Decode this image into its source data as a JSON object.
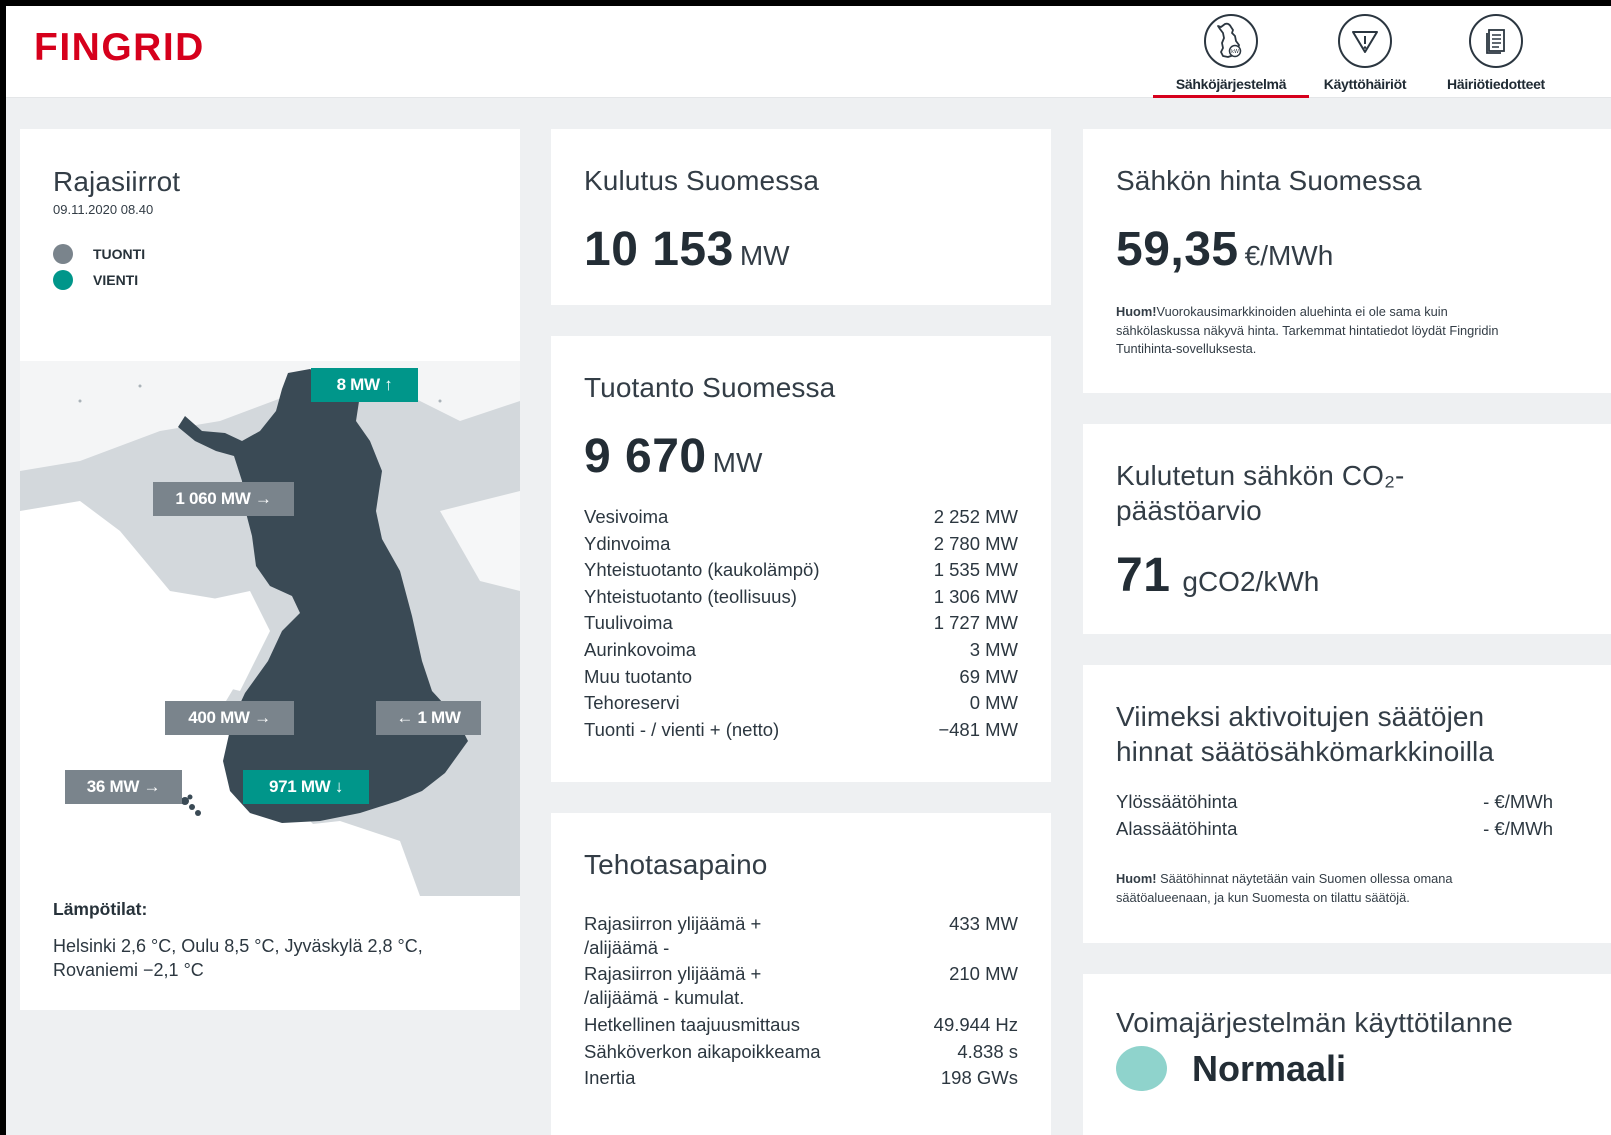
{
  "header": {
    "logo": "FINGRID",
    "nav": [
      {
        "label": "Sähköjärjestelmä",
        "icon": "finland-map-icon",
        "active": true
      },
      {
        "label": "Käyttöhäiriöt",
        "icon": "warning-triangle-icon",
        "active": false
      },
      {
        "label": "Häiriötiedotteet",
        "icon": "document-icon",
        "active": false
      }
    ]
  },
  "rajasiirrot": {
    "title": "Rajasiirrot",
    "timestamp": "09.11.2020 08.40",
    "legend": {
      "import": "TUONTI",
      "export": "VIENTI",
      "import_color": "#7a848c",
      "export_color": "#00968a"
    },
    "flows": {
      "north": "8 MW ↑",
      "sweden_north": "1 060 MW →",
      "sweden_south": "400 MW →",
      "russia": "← 1 MW",
      "aland": "36 MW →",
      "estonia": "971 MW ↓"
    },
    "temperatures_label": "Lämpötilat:",
    "temperatures_text": "Helsinki 2,6 °C, Oulu 8,5 °C, Jyväskylä 2,8 °C, Rovaniemi −2,1 °C"
  },
  "kulutus": {
    "title": "Kulutus Suomessa",
    "value": "10 153",
    "unit": "MW"
  },
  "tuotanto": {
    "title": "Tuotanto Suomessa",
    "value": "9 670",
    "unit": "MW",
    "rows": [
      {
        "label": "Vesivoima",
        "value": "2 252 MW"
      },
      {
        "label": "Ydinvoima",
        "value": "2 780 MW"
      },
      {
        "label": "Yhteistuotanto (kaukolämpö)",
        "value": "1 535 MW"
      },
      {
        "label": "Yhteistuotanto (teollisuus)",
        "value": "1 306 MW"
      },
      {
        "label": "Tuulivoima",
        "value": "1 727 MW"
      },
      {
        "label": "Aurinkovoima",
        "value": "3 MW"
      },
      {
        "label": "Muu tuotanto",
        "value": "69 MW"
      },
      {
        "label": "Tehoreservi",
        "value": "0 MW"
      },
      {
        "label": "Tuonti - / vienti + (netto)",
        "value": "−481 MW"
      }
    ]
  },
  "tehotasapaino": {
    "title": "Tehotasapaino",
    "rows": [
      {
        "label": "Rajasiirron ylijäämä + /alijäämä -",
        "value": "433 MW"
      },
      {
        "label": "Rajasiirron ylijäämä + /alijäämä - kumulat.",
        "value": "210 MW"
      },
      {
        "label": "Hetkellinen taajuusmittaus",
        "value": "49.944 Hz"
      },
      {
        "label": "Sähköverkon aikapoikkeama",
        "value": "4.838 s"
      },
      {
        "label": "Inertia",
        "value": "198 GWs"
      }
    ]
  },
  "hinta": {
    "title": "Sähkön hinta Suomessa",
    "value": "59,35",
    "unit": "€/MWh",
    "note_bold": "Huom!",
    "note_text": "Vuorokausimarkkinoiden aluehinta ei ole sama kuin sähkölaskussa näkyvä hinta. Tarkemmat hintatiedot löydät Fingridin Tuntihinta-sovelluksesta."
  },
  "co2": {
    "title_line1": "Kulutetun sähkön CO₂-",
    "title_line2": "päästöarvio",
    "value": "71",
    "unit": "gCO2/kWh"
  },
  "saadot": {
    "title_line1": "Viimeksi aktivoitujen säätöjen",
    "title_line2": "hinnat säätösähkömarkkinoilla",
    "rows": [
      {
        "label": "Ylössäätöhinta",
        "value": "- €/MWh"
      },
      {
        "label": "Alassäätöhinta",
        "value": "- €/MWh"
      }
    ],
    "note_bold": "Huom!",
    "note_text": " Säätöhinnat näytetään vain Suomen ollessa omana säätöalueenaan, ja kun Suomesta on tilattu säätöjä."
  },
  "kayttotilanne": {
    "title": "Voimajärjestelmän käyttötilanne",
    "status": "Normaali",
    "status_color": "#8fd3cc"
  }
}
